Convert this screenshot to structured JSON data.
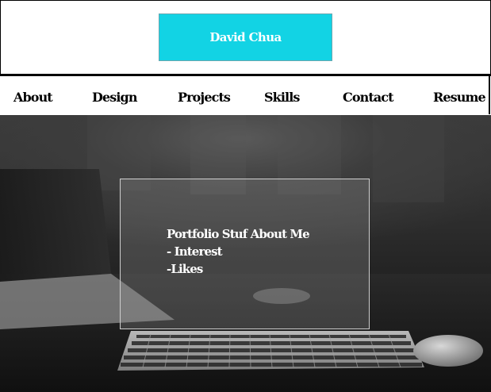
{
  "header": {
    "logo_text": "David Chua",
    "accent_color": "#12d3e4"
  },
  "nav": {
    "items": [
      {
        "label": "About"
      },
      {
        "label": "Design"
      },
      {
        "label": "Projects"
      },
      {
        "label": "Skills"
      },
      {
        "label": "Contact"
      },
      {
        "label": "Resume"
      }
    ]
  },
  "hero": {
    "lines": [
      "Portfolio Stuf About Me",
      "- Interest",
      "-Likes"
    ]
  }
}
